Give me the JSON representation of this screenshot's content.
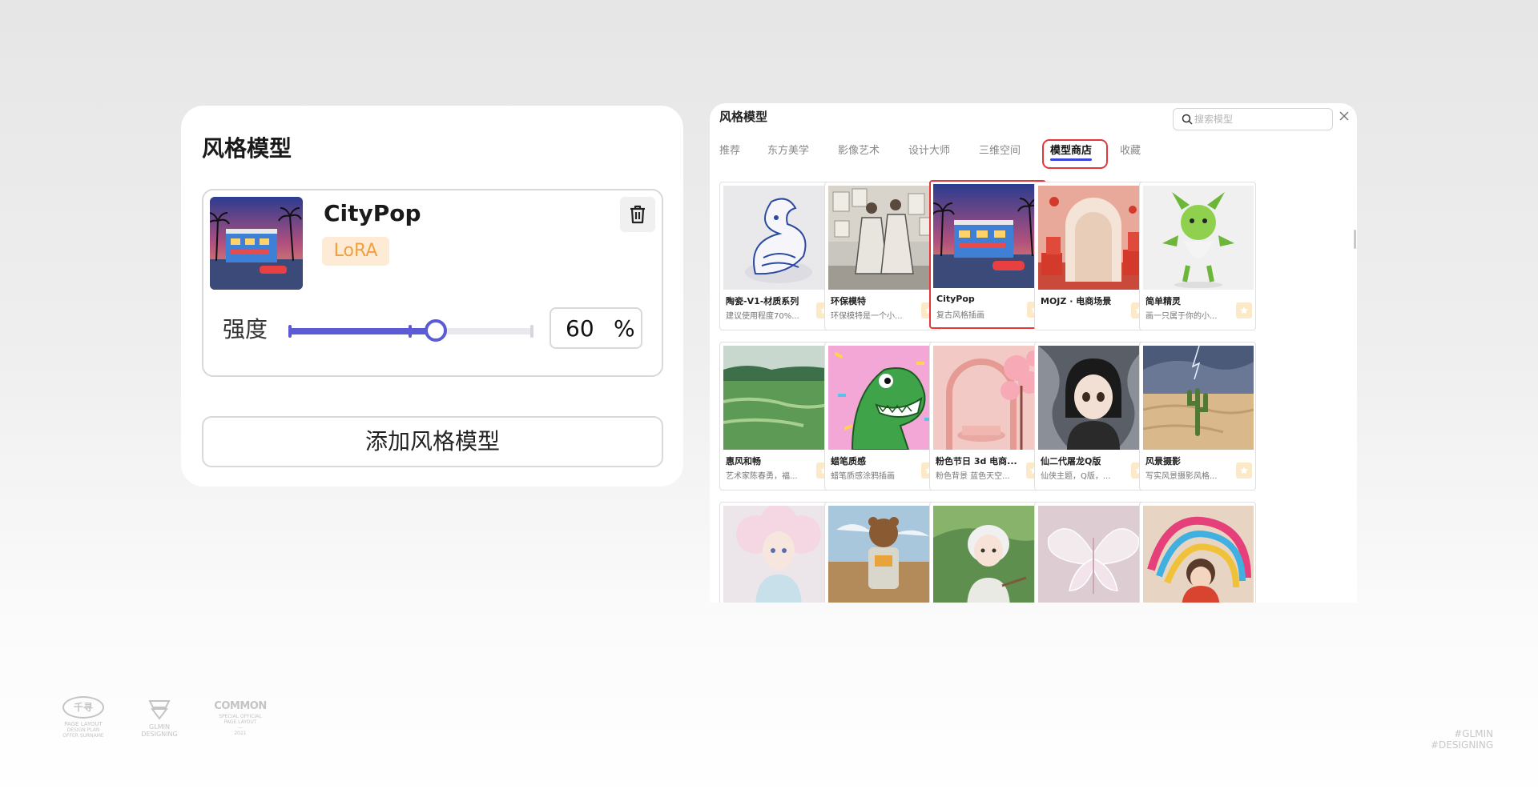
{
  "left_card": {
    "title": "风格模型",
    "model": {
      "name": "CityPop",
      "badge": "LoRA",
      "strength_label": "强度",
      "strength_value": "60",
      "strength_unit": "%",
      "strength_fraction": 0.6
    },
    "add_button": "添加风格模型"
  },
  "right_panel": {
    "title": "风格模型",
    "search_placeholder": "搜索模型",
    "tabs": [
      {
        "label": "推荐",
        "active": false
      },
      {
        "label": "东方美学",
        "active": false
      },
      {
        "label": "影像艺术",
        "active": false
      },
      {
        "label": "设计大师",
        "active": false
      },
      {
        "label": "三维空间",
        "active": false
      },
      {
        "label": "模型商店",
        "active": true
      },
      {
        "label": "收藏",
        "active": false
      }
    ],
    "cards": [
      {
        "title": "陶瓷-V1-材质系列",
        "desc": "建议使用程度70%...",
        "selected": false,
        "art": "dragon"
      },
      {
        "title": "环保模特",
        "desc": "环保模特是一个小...",
        "selected": false,
        "art": "fashion"
      },
      {
        "title": "CityPop",
        "desc": "复古风格插画",
        "selected": true,
        "art": "citypop"
      },
      {
        "title": "MOJZ · 电商场景",
        "desc": "",
        "selected": false,
        "art": "arch"
      },
      {
        "title": "简单精灵",
        "desc": "画一只属于你的小...",
        "selected": false,
        "art": "sprite"
      },
      {
        "title": "惠风和畅",
        "desc": "艺术家陈春勇，福...",
        "selected": false,
        "art": "meadow"
      },
      {
        "title": "蜡笔质感",
        "desc": "蜡笔质感涂鸦插画",
        "selected": false,
        "art": "dino"
      },
      {
        "title": "粉色节日 3d 电商...",
        "desc": "粉色背景 蓝色天空...",
        "selected": false,
        "art": "pink"
      },
      {
        "title": "仙二代屠龙Q版",
        "desc": "仙侠主题，Q版，...",
        "selected": false,
        "art": "girl"
      },
      {
        "title": "风景摄影",
        "desc": "写实风景摄影风格...",
        "selected": false,
        "art": "desert"
      },
      {
        "title": "",
        "desc": "",
        "selected": false,
        "art": "doll"
      },
      {
        "title": "",
        "desc": "",
        "selected": false,
        "art": "bear"
      },
      {
        "title": "",
        "desc": "",
        "selected": false,
        "art": "boy"
      },
      {
        "title": "",
        "desc": "",
        "selected": false,
        "art": "butterfly"
      },
      {
        "title": "",
        "desc": "",
        "selected": false,
        "art": "rainbow"
      }
    ]
  },
  "footer": {
    "logo1_mark": "千寻",
    "logo1_lines": [
      "PAGE LAYOUT",
      "DESIGN PLAN",
      "OFFER SURNAME"
    ],
    "logo2_lines": [
      "GLMIN",
      "DESIGNING"
    ],
    "logo3_mark": "COMMON",
    "logo3_lines": [
      "SPECIAL OFFICIAL",
      "PAGE LAYOUT",
      "—",
      "2021"
    ],
    "hashtags": [
      "#GLMIN",
      "#DESIGNING"
    ]
  },
  "colors": {
    "accent": "#5b5bd6",
    "tab_underline": "#3b45d8",
    "highlight_red": "#e2373b",
    "badge_bg": "#fdebd5",
    "badge_text": "#f0a040"
  }
}
